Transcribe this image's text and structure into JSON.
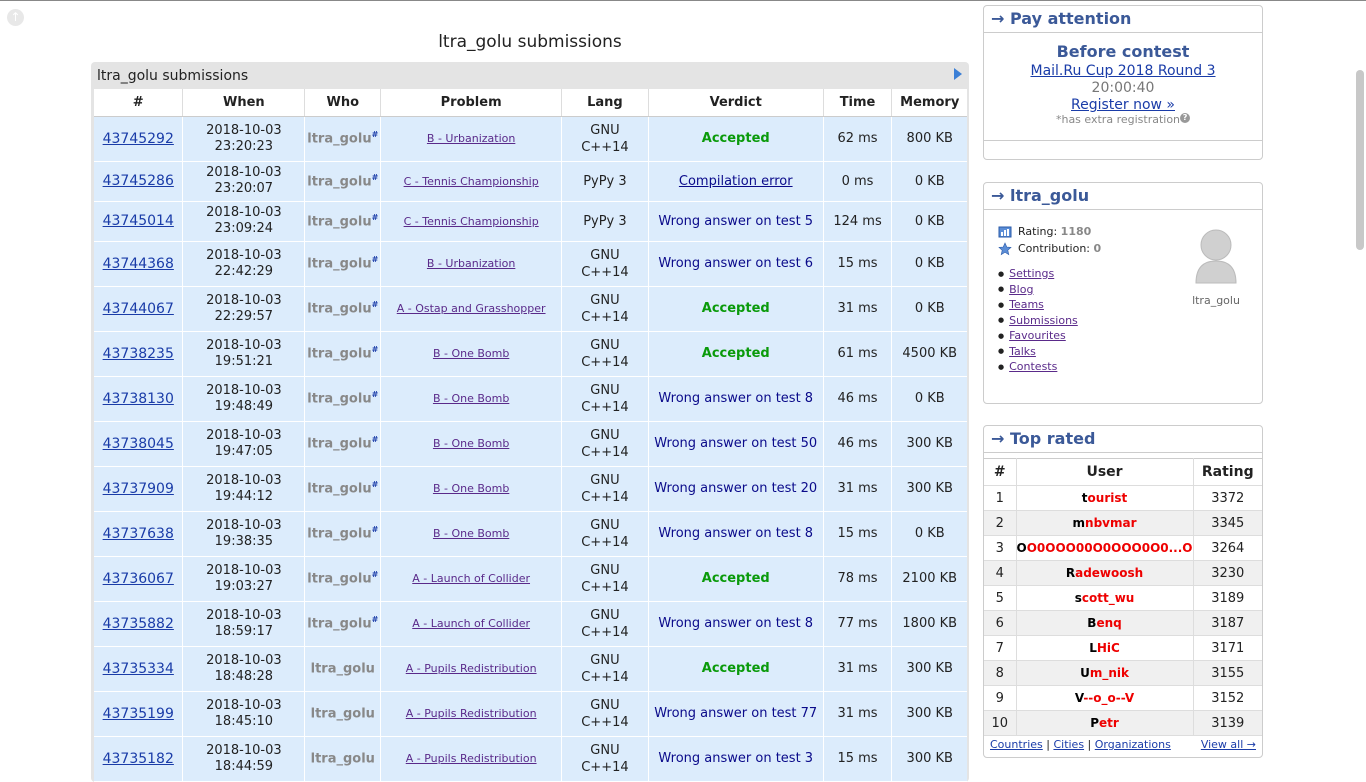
{
  "page_title": "ltra_golu submissions",
  "frame_title": "ltra_golu submissions",
  "columns": [
    "#",
    "When",
    "Who",
    "Problem",
    "Lang",
    "Verdict",
    "Time",
    "Memory"
  ],
  "rows": [
    {
      "id": "43745292",
      "date": "2018-10-03",
      "time": "23:20:23",
      "who": "ltra_golu",
      "mark": "#",
      "problem": "B - Urbanization",
      "lang1": "GNU",
      "lang2": "C++14",
      "verdict": "Accepted",
      "vclass": "ok",
      "run": "62 ms",
      "mem": "800 KB"
    },
    {
      "id": "43745286",
      "date": "2018-10-03",
      "time": "23:20:07",
      "who": "ltra_golu",
      "mark": "#",
      "problem": "C - Tennis Championship",
      "lang1": "PyPy 3",
      "lang2": "",
      "verdict": "Compilation error",
      "vclass": "ce",
      "run": "0 ms",
      "mem": "0 KB"
    },
    {
      "id": "43745014",
      "date": "2018-10-03",
      "time": "23:09:24",
      "who": "ltra_golu",
      "mark": "#",
      "problem": "C - Tennis Championship",
      "lang1": "PyPy 3",
      "lang2": "",
      "verdict": "Wrong answer on test 5",
      "vclass": "wa",
      "run": "124 ms",
      "mem": "0 KB"
    },
    {
      "id": "43744368",
      "date": "2018-10-03",
      "time": "22:42:29",
      "who": "ltra_golu",
      "mark": "#",
      "problem": "B - Urbanization",
      "lang1": "GNU",
      "lang2": "C++14",
      "verdict": "Wrong answer on test 6",
      "vclass": "wa",
      "run": "15 ms",
      "mem": "0 KB"
    },
    {
      "id": "43744067",
      "date": "2018-10-03",
      "time": "22:29:57",
      "who": "ltra_golu",
      "mark": "#",
      "problem": "A - Ostap and Grasshopper",
      "lang1": "GNU",
      "lang2": "C++14",
      "verdict": "Accepted",
      "vclass": "ok",
      "run": "31 ms",
      "mem": "0 KB"
    },
    {
      "id": "43738235",
      "date": "2018-10-03",
      "time": "19:51:21",
      "who": "ltra_golu",
      "mark": "#",
      "problem": "B - One Bomb",
      "lang1": "GNU",
      "lang2": "C++14",
      "verdict": "Accepted",
      "vclass": "ok",
      "run": "61 ms",
      "mem": "4500 KB"
    },
    {
      "id": "43738130",
      "date": "2018-10-03",
      "time": "19:48:49",
      "who": "ltra_golu",
      "mark": "#",
      "problem": "B - One Bomb",
      "lang1": "GNU",
      "lang2": "C++14",
      "verdict": "Wrong answer on test 8",
      "vclass": "wa",
      "run": "46 ms",
      "mem": "0 KB"
    },
    {
      "id": "43738045",
      "date": "2018-10-03",
      "time": "19:47:05",
      "who": "ltra_golu",
      "mark": "#",
      "problem": "B - One Bomb",
      "lang1": "GNU",
      "lang2": "C++14",
      "verdict": "Wrong answer on test 50",
      "vclass": "wa",
      "run": "46 ms",
      "mem": "300 KB"
    },
    {
      "id": "43737909",
      "date": "2018-10-03",
      "time": "19:44:12",
      "who": "ltra_golu",
      "mark": "#",
      "problem": "B - One Bomb",
      "lang1": "GNU",
      "lang2": "C++14",
      "verdict": "Wrong answer on test 20",
      "vclass": "wa",
      "run": "31 ms",
      "mem": "300 KB"
    },
    {
      "id": "43737638",
      "date": "2018-10-03",
      "time": "19:38:35",
      "who": "ltra_golu",
      "mark": "#",
      "problem": "B - One Bomb",
      "lang1": "GNU",
      "lang2": "C++14",
      "verdict": "Wrong answer on test 8",
      "vclass": "wa",
      "run": "15 ms",
      "mem": "0 KB"
    },
    {
      "id": "43736067",
      "date": "2018-10-03",
      "time": "19:03:27",
      "who": "ltra_golu",
      "mark": "#",
      "problem": "A - Launch of Collider",
      "lang1": "GNU",
      "lang2": "C++14",
      "verdict": "Accepted",
      "vclass": "ok",
      "run": "78 ms",
      "mem": "2100 KB"
    },
    {
      "id": "43735882",
      "date": "2018-10-03",
      "time": "18:59:17",
      "who": "ltra_golu",
      "mark": "#",
      "problem": "A - Launch of Collider",
      "lang1": "GNU",
      "lang2": "C++14",
      "verdict": "Wrong answer on test 8",
      "vclass": "wa",
      "run": "77 ms",
      "mem": "1800 KB"
    },
    {
      "id": "43735334",
      "date": "2018-10-03",
      "time": "18:48:28",
      "who": "ltra_golu",
      "mark": "",
      "problem": "A - Pupils Redistribution",
      "lang1": "GNU",
      "lang2": "C++14",
      "verdict": "Accepted",
      "vclass": "ok",
      "run": "31 ms",
      "mem": "300 KB"
    },
    {
      "id": "43735199",
      "date": "2018-10-03",
      "time": "18:45:10",
      "who": "ltra_golu",
      "mark": "",
      "problem": "A - Pupils Redistribution",
      "lang1": "GNU",
      "lang2": "C++14",
      "verdict": "Wrong answer on test 77",
      "vclass": "wa",
      "run": "31 ms",
      "mem": "300 KB"
    },
    {
      "id": "43735182",
      "date": "2018-10-03",
      "time": "18:44:59",
      "who": "ltra_golu",
      "mark": "",
      "problem": "A - Pupils Redistribution",
      "lang1": "GNU",
      "lang2": "C++14",
      "verdict": "Wrong answer on test 3",
      "vclass": "wa",
      "run": "15 ms",
      "mem": "300 KB"
    }
  ],
  "pay": {
    "title": "→ Pay attention",
    "before": "Before contest",
    "contest": "Mail.Ru Cup 2018 Round 3",
    "timer": "20:00:40",
    "register": "Register now »",
    "note": "*has extra registration",
    "help": "?"
  },
  "profile": {
    "title": "→ ltra_golu",
    "rating_label": "Rating:",
    "rating": "1180",
    "contribution_label": "Contribution:",
    "contribution": "0",
    "links": [
      "Settings",
      "Blog",
      "Teams",
      "Submissions",
      "Favourites",
      "Talks",
      "Contests"
    ],
    "avatar_name": "ltra_golu"
  },
  "top_rated": {
    "title": "→ Top rated",
    "headers": [
      "#",
      "User",
      "Rating"
    ],
    "rows": [
      {
        "rank": "1",
        "first": "t",
        "rest": "ourist",
        "rating": "3372"
      },
      {
        "rank": "2",
        "first": "m",
        "rest": "nbvmar",
        "rating": "3345"
      },
      {
        "rank": "3",
        "first": "O",
        "rest": "O0OOO00O0OOO0O0...O",
        "rating": "3264"
      },
      {
        "rank": "4",
        "first": "R",
        "rest": "adewoosh",
        "rating": "3230"
      },
      {
        "rank": "5",
        "first": "s",
        "rest": "cott_wu",
        "rating": "3189"
      },
      {
        "rank": "6",
        "first": "B",
        "rest": "enq",
        "rating": "3187"
      },
      {
        "rank": "7",
        "first": "L",
        "rest": "HiC",
        "rating": "3171"
      },
      {
        "rank": "8",
        "first": "U",
        "rest": "m_nik",
        "rating": "3155"
      },
      {
        "rank": "9",
        "first": "V",
        "rest": "--o_o--V",
        "rating": "3152"
      },
      {
        "rank": "10",
        "first": "P",
        "rest": "etr",
        "rating": "3139"
      }
    ],
    "footer": [
      "Countries",
      "Cities",
      "Organizations"
    ],
    "view_all": "View all →"
  }
}
